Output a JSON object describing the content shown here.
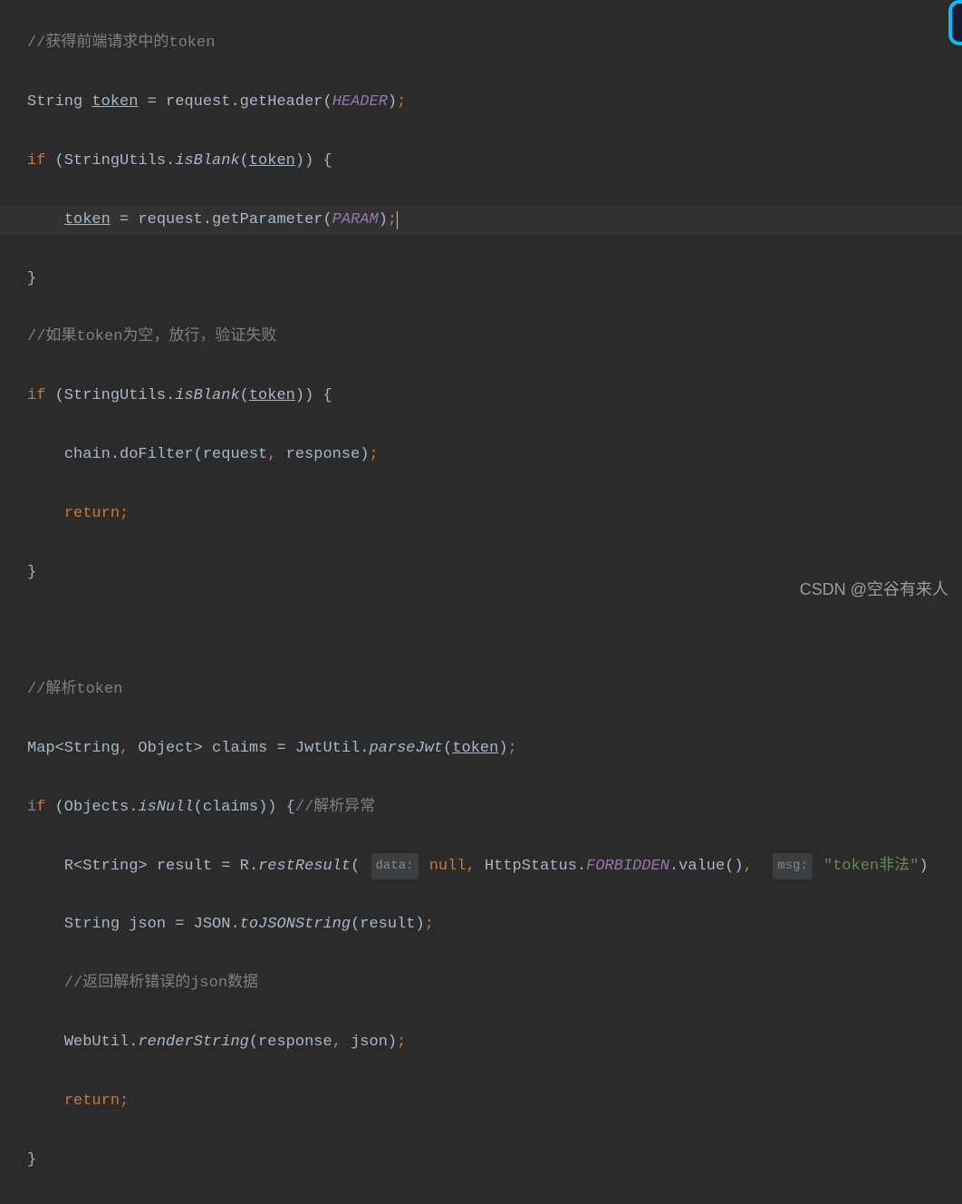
{
  "code": {
    "line1_comment": "//获得前端请求中的token",
    "line2": {
      "type": "String ",
      "var": "token",
      "assign": " = request.getHeader(",
      "const": "HEADER",
      "end": ")"
    },
    "line3": {
      "if": "if",
      "open": " (StringUtils.",
      "method": "isBlank",
      "args": "(",
      "token": "token",
      "close": ")) {"
    },
    "line4": {
      "indent": "    ",
      "var": "token",
      "assign": " = request.getParameter(",
      "const": "PARAM",
      "end": ")"
    },
    "line5": "}",
    "line6_comment": "//如果token为空，放行，验证失败",
    "line7": {
      "if": "if",
      "open": " (StringUtils.",
      "method": "isBlank",
      "args": "(",
      "token": "token",
      "close": ")) {"
    },
    "line8": {
      "indent": "    ",
      "call": "chain.doFilter(request",
      "comma": ",",
      "rest": " response)"
    },
    "line9": {
      "indent": "    ",
      "return": "return"
    },
    "line10": "}",
    "line12_comment": "//解析token",
    "line13": {
      "type": "Map<String",
      "comma1": ",",
      "type2": " Object> claims = JwtUtil.",
      "method": "parseJwt",
      "args": "(",
      "token": "token",
      "close": ")"
    },
    "line14": {
      "if": "if",
      "open": " (Objects.",
      "method": "isNull",
      "args": "(claims)) {",
      "comment": "//解析异常"
    },
    "line15": {
      "indent": "    ",
      "decl": "R<String> result = R.",
      "method": "restResult",
      "open": "( ",
      "hint1": "data:",
      "null": " null",
      "comma1": ",",
      "http": " HttpStatus.",
      "forbidden": "FORBIDDEN",
      "value": ".value()",
      "comma2": ",",
      "sp": "  ",
      "hint2": "msg:",
      "str": " \"token非法\"",
      "close": ")"
    },
    "line16": {
      "indent": "    ",
      "decl": "String json = JSON.",
      "method": "toJSONString",
      "args": "(result)"
    },
    "line17_comment": "    //返回解析错误的json数据",
    "line18": {
      "indent": "    ",
      "call": "WebUtil.",
      "method": "renderString",
      "args": "(response",
      "comma": ",",
      "rest": " json)"
    },
    "line19": {
      "indent": "    ",
      "return": "return"
    },
    "line20": "}"
  },
  "watermark": "CSDN @空谷有来人"
}
